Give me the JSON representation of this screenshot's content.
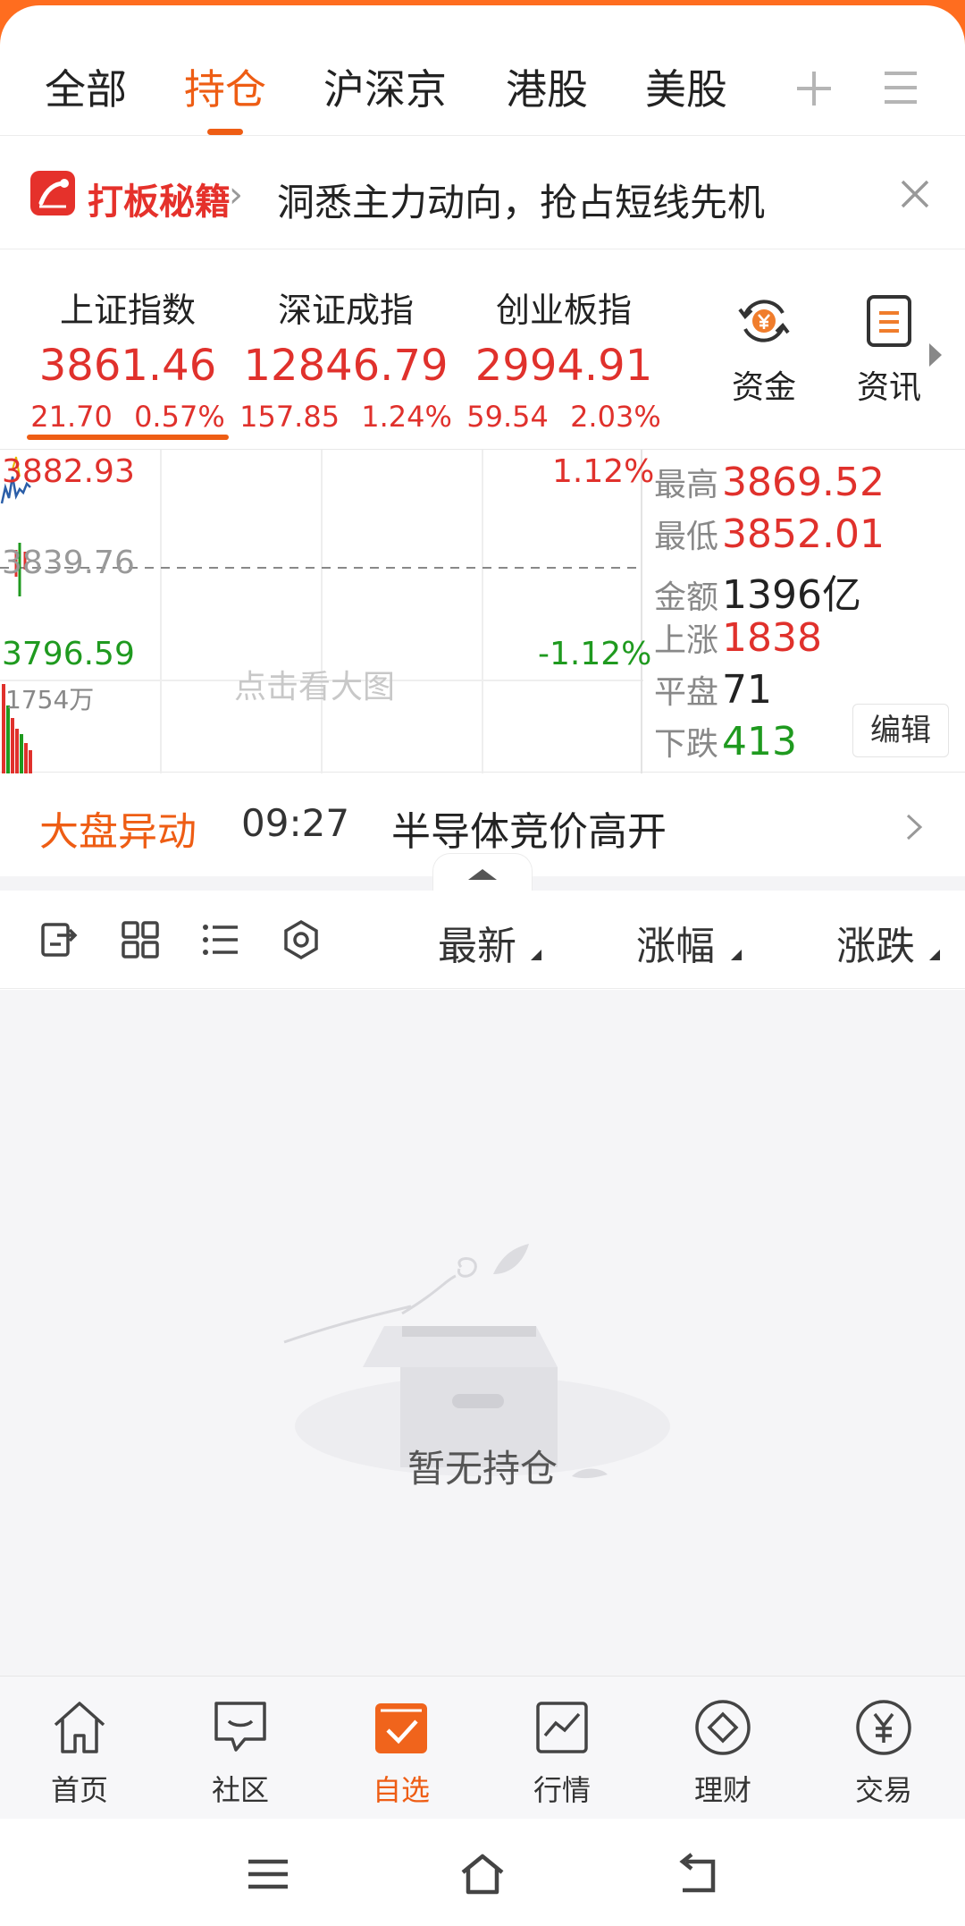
{
  "tabs": [
    {
      "label": "全部"
    },
    {
      "label": "持仓"
    },
    {
      "label": "沪深京"
    },
    {
      "label": "港股"
    },
    {
      "label": "美股"
    }
  ],
  "active_tab": "持仓",
  "banner": {
    "brand": "打板秘籍",
    "text": "洞悉主力动向，抢占短线先机"
  },
  "indices": [
    {
      "name": "上证指数",
      "value": "3861.46",
      "change": "21.70",
      "pct": "0.57%"
    },
    {
      "name": "深证成指",
      "value": "12846.79",
      "change": "157.85",
      "pct": "1.24%"
    },
    {
      "name": "创业板指",
      "value": "2994.91",
      "change": "59.54",
      "pct": "2.03%"
    }
  ],
  "tools": [
    {
      "label": "资金",
      "icon": "yuan-refresh-icon"
    },
    {
      "label": "资讯",
      "icon": "document-icon"
    }
  ],
  "chart": {
    "high_label": "3882.93",
    "mid_label": "3839.76",
    "low_label": "3796.59",
    "pct_up": "1.12%",
    "pct_down": "-1.12%",
    "volume_label": "1754万",
    "hint": "点击看大图",
    "colors": {
      "up": "#e0312c",
      "down": "#1f9a1f",
      "line": "#2b5ea8"
    }
  },
  "stats": {
    "high_key": "最高",
    "high": "3869.52",
    "low_key": "最低",
    "low": "3852.01",
    "amount_key": "金额",
    "amount": "1396亿",
    "up_key": "上涨",
    "up": "1838",
    "flat_key": "平盘",
    "flat": "71",
    "down_key": "下跌",
    "down": "413",
    "edit": "编辑"
  },
  "market_move": {
    "title": "大盘异动",
    "time": "09:27",
    "text": "半导体竞价高开"
  },
  "list_header": {
    "latest": "最新",
    "change_pct": "涨幅",
    "change": "涨跌"
  },
  "empty_text": "暂无持仓",
  "bottom_nav": [
    {
      "label": "首页",
      "icon": "home-icon"
    },
    {
      "label": "社区",
      "icon": "chat-icon"
    },
    {
      "label": "自选",
      "icon": "watchlist-icon"
    },
    {
      "label": "行情",
      "icon": "chart-icon"
    },
    {
      "label": "理财",
      "icon": "diamond-icon"
    },
    {
      "label": "交易",
      "icon": "yuan-icon"
    }
  ],
  "accent_color": "#ee5d14"
}
